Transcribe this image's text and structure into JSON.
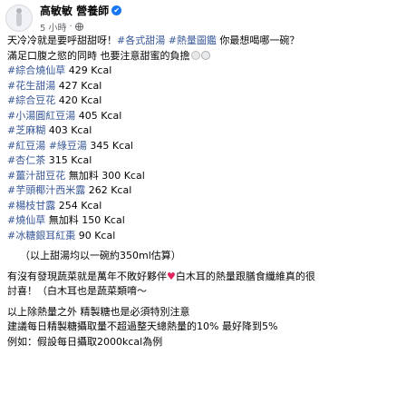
{
  "header": {
    "name": "高敏敏 營養師",
    "verified_icon": "✔",
    "time": "5 小時",
    "separator": "·",
    "privacy_icon": "globe-icon"
  },
  "post": {
    "line1": {
      "text": "天冷冷就是要呼甜甜呀！",
      "tag1": "#各式甜湯",
      "tag2": "#熱量圖鑑",
      "tail": " 你最想喝哪一碗？"
    },
    "line2": {
      "text": "滿足口腹之慾的同時 也要注意甜蜜的負擔"
    },
    "items": [
      {
        "tag": "#綜合燒仙草",
        "value": " 429 Kcal"
      },
      {
        "tag": "#花生甜湯",
        "value": " 427 Kcal"
      },
      {
        "tag": "#綜合豆花",
        "value": " 420 Kcal"
      },
      {
        "tag": "#小湯圓紅豆湯",
        "value": " 405 Kcal"
      },
      {
        "tag": "#芝麻糊",
        "value": " 403 Kcal"
      },
      {
        "tag": "#紅豆湯",
        "mid": " ",
        "tag2": "#綠豆湯",
        "value": " 345 Kcal"
      },
      {
        "tag": "#杏仁茶",
        "value": " 315 Kcal"
      },
      {
        "tag": "#薑汁甜豆花",
        "value": " 無加料 300 Kcal"
      },
      {
        "tag": "#芋頭椰汁西米露",
        "value": " 262 Kcal"
      },
      {
        "tag": "#楊枝甘露",
        "value": " 254 Kcal"
      },
      {
        "tag": "#燒仙草",
        "value": " 無加料 150 Kcal"
      },
      {
        "tag": "#冰糖銀耳紅棗",
        "value": " 90 Kcal"
      }
    ],
    "note": "（以上甜湯均以一碗約350ml估算）",
    "para1": {
      "text_a": "有沒有發現蔬菜就是萬年不敗好夥伴",
      "text_b": "白木耳的熱量跟膳食纖維真的很",
      "text_c": "討喜！（白木耳也是蔬菜類唷～"
    },
    "para2": {
      "line1": "以上除熱量之外 精製糖也是必須特別注意",
      "line2": "建議每日精製糖攝取量不超過整天總熱量的10% 最好降到5%",
      "line3": "例如：假設每日攝取2000kcal為例"
    }
  }
}
